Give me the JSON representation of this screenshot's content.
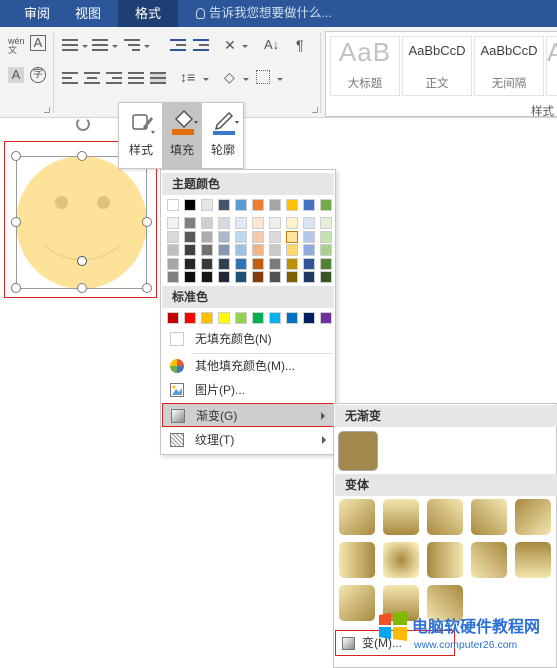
{
  "ribbon_tabs": [
    {
      "label": "审阅",
      "active": false
    },
    {
      "label": "视图",
      "active": false
    },
    {
      "label": "格式",
      "active": true
    }
  ],
  "tell_me": "告诉我您想要做什么...",
  "ribbon": {
    "styles": [
      {
        "preview": "AaB",
        "label": "大标题"
      },
      {
        "preview": "AaBbCcD",
        "label": "正文"
      },
      {
        "preview": "AaBbCcD",
        "label": "无间隔"
      }
    ],
    "group_label": "样式"
  },
  "mini_toolbar": {
    "style": "样式",
    "fill": "填充",
    "outline": "轮廓",
    "fill_accent": "#e46c0a",
    "outline_accent": "#3b78c5"
  },
  "fill_menu": {
    "theme_colors_header": "主题颜色",
    "standard_colors_header": "标准色",
    "theme_top": [
      "#ffffff",
      "#000000",
      "#e7e6e6",
      "#44546a",
      "#5b9bd5",
      "#ed7d31",
      "#a5a5a5",
      "#ffc000",
      "#4472c4",
      "#70ad47"
    ],
    "theme_shades": [
      [
        "#f2f2f2",
        "#808080",
        "#d0cece",
        "#d6dce4",
        "#deebf6",
        "#fbe5d5",
        "#ededed",
        "#fff2cc",
        "#dae3f3",
        "#e2efd9"
      ],
      [
        "#d9d9d9",
        "#595959",
        "#aeabab",
        "#adb9ca",
        "#bdd7ee",
        "#f8cbad",
        "#dbdbdb",
        "#fee599",
        "#b4c7e7",
        "#c5e0b3"
      ],
      [
        "#bfbfbf",
        "#404040",
        "#767171",
        "#8496b0",
        "#9cc3e5",
        "#f4b183",
        "#c9c9c9",
        "#ffd966",
        "#8faadc",
        "#a8d08d"
      ],
      [
        "#a6a6a6",
        "#262626",
        "#3a3838",
        "#323f4f",
        "#2e75b5",
        "#c55a11",
        "#7b7b7b",
        "#bf9000",
        "#2f5496",
        "#538135"
      ],
      [
        "#7f7f7f",
        "#0d0d0d",
        "#171616",
        "#222a35",
        "#1f4e79",
        "#833c0b",
        "#525252",
        "#7f6000",
        "#1f3864",
        "#375623"
      ]
    ],
    "standard": [
      "#c00000",
      "#ff0000",
      "#ffc000",
      "#ffff00",
      "#92d050",
      "#00b050",
      "#00b0f0",
      "#0070c0",
      "#002060",
      "#7030a0"
    ],
    "no_fill": "无填充颜色(N)",
    "more_colors": "其他填充颜色(M)...",
    "picture": "图片(P)...",
    "gradient": "渐变(G)",
    "texture": "纹理(T)"
  },
  "gradient_menu": {
    "no_gradient_header": "无渐变",
    "variants_header": "变体",
    "more_gradients": "变(M)...",
    "base_color": "#a3884d"
  },
  "watermark": {
    "line1": "电脑软硬件教程网",
    "line2": "www.computer26.com"
  }
}
